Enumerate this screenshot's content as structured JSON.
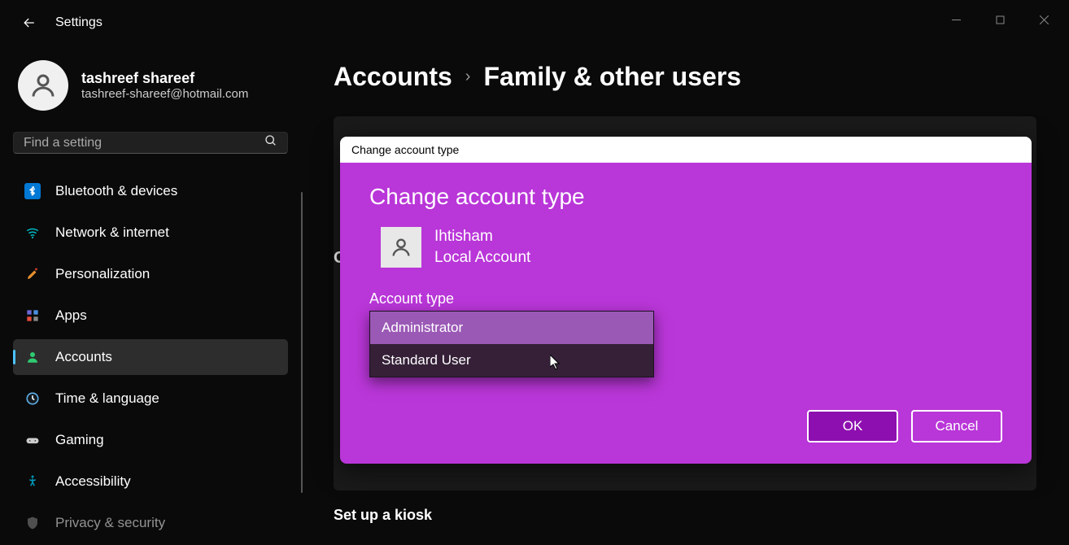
{
  "app": {
    "title": "Settings"
  },
  "profile": {
    "name": "tashreef shareef",
    "email": "tashreef-shareef@hotmail.com"
  },
  "search": {
    "placeholder": "Find a setting"
  },
  "nav": {
    "items": [
      {
        "icon": "bluetooth",
        "label": "Bluetooth & devices",
        "color": "#0078d4"
      },
      {
        "icon": "wifi",
        "label": "Network & internet",
        "color": "#00b7c3"
      },
      {
        "icon": "brush",
        "label": "Personalization",
        "color": "#e8912d"
      },
      {
        "icon": "apps",
        "label": "Apps",
        "color": "#6b69d6"
      },
      {
        "icon": "person",
        "label": "Accounts",
        "color": "#2ecc71",
        "active": true
      },
      {
        "icon": "clock",
        "label": "Time & language",
        "color": "#5fb0e8"
      },
      {
        "icon": "gamepad",
        "label": "Gaming",
        "color": "#cccccc"
      },
      {
        "icon": "accessibility",
        "label": "Accessibility",
        "color": "#0099bc"
      },
      {
        "icon": "shield",
        "label": "Privacy & security",
        "color": "#888888"
      }
    ]
  },
  "breadcrumb": {
    "parent": "Accounts",
    "current": "Family & other users"
  },
  "section": {
    "letter": "O",
    "kiosk_label": "Set up a kiosk"
  },
  "dialog": {
    "titlebar": "Change account type",
    "heading": "Change account type",
    "user_name": "Ihtisham",
    "user_type": "Local Account",
    "field_label": "Account type",
    "options": [
      "Administrator",
      "Standard User"
    ],
    "ok": "OK",
    "cancel": "Cancel"
  }
}
